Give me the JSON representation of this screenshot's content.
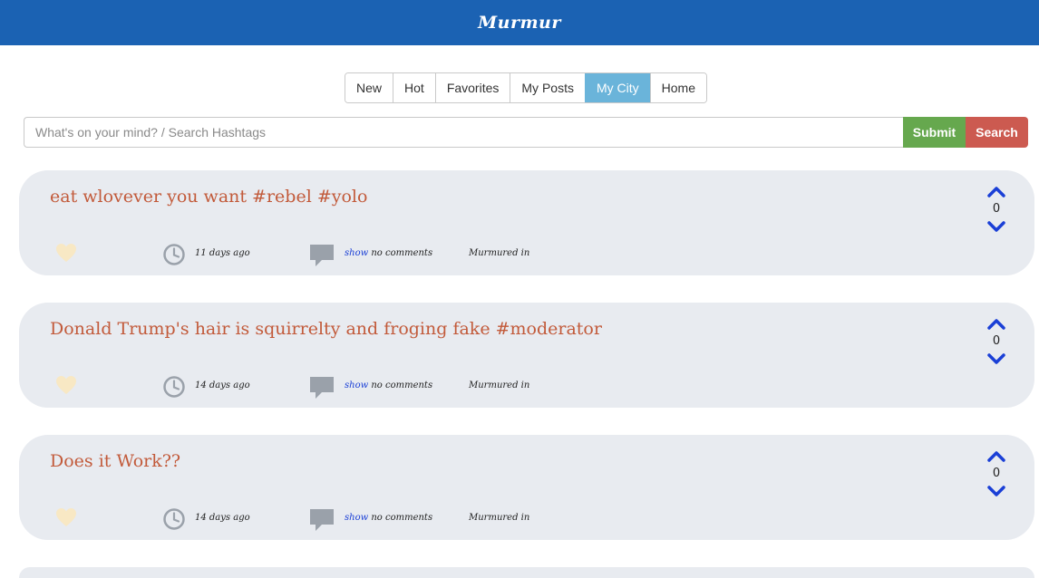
{
  "app": {
    "title": "Murmur"
  },
  "tabs": [
    {
      "label": "New",
      "active": false
    },
    {
      "label": "Hot",
      "active": false
    },
    {
      "label": "Favorites",
      "active": false
    },
    {
      "label": "My Posts",
      "active": false
    },
    {
      "label": "My City",
      "active": true
    },
    {
      "label": "Home",
      "active": false
    }
  ],
  "composer": {
    "placeholder": "What's on your mind? / Search Hashtags",
    "value": "",
    "submit_label": "Submit",
    "search_label": "Search"
  },
  "colors": {
    "header": "#1b62b3",
    "active_tab": "#6ab4da",
    "submit": "#66a84e",
    "search": "#cc5a50",
    "post_text": "#c25a3a",
    "card_bg": "#e8ebf0",
    "vote_arrow": "#1a3fd6"
  },
  "icons": {
    "like": "heart-icon",
    "time": "clock-icon",
    "comment": "comment-bubble-icon",
    "upvote": "chevron-up-icon",
    "downvote": "chevron-down-icon"
  },
  "posts": [
    {
      "text": "eat wlovever you want #rebel #yolo",
      "votes": "0",
      "time_ago": "11 days ago",
      "show_label": "show",
      "comments_label": "no comments",
      "murmured_label": "Murmured in"
    },
    {
      "text": "Donald Trump's hair is squirrelty and froging fake #moderator",
      "votes": "0",
      "time_ago": "14 days ago",
      "show_label": "show",
      "comments_label": "no comments",
      "murmured_label": "Murmured in"
    },
    {
      "text": "Does it Work??",
      "votes": "0",
      "time_ago": "14 days ago",
      "show_label": "show",
      "comments_label": "no comments",
      "murmured_label": "Murmured in"
    }
  ]
}
